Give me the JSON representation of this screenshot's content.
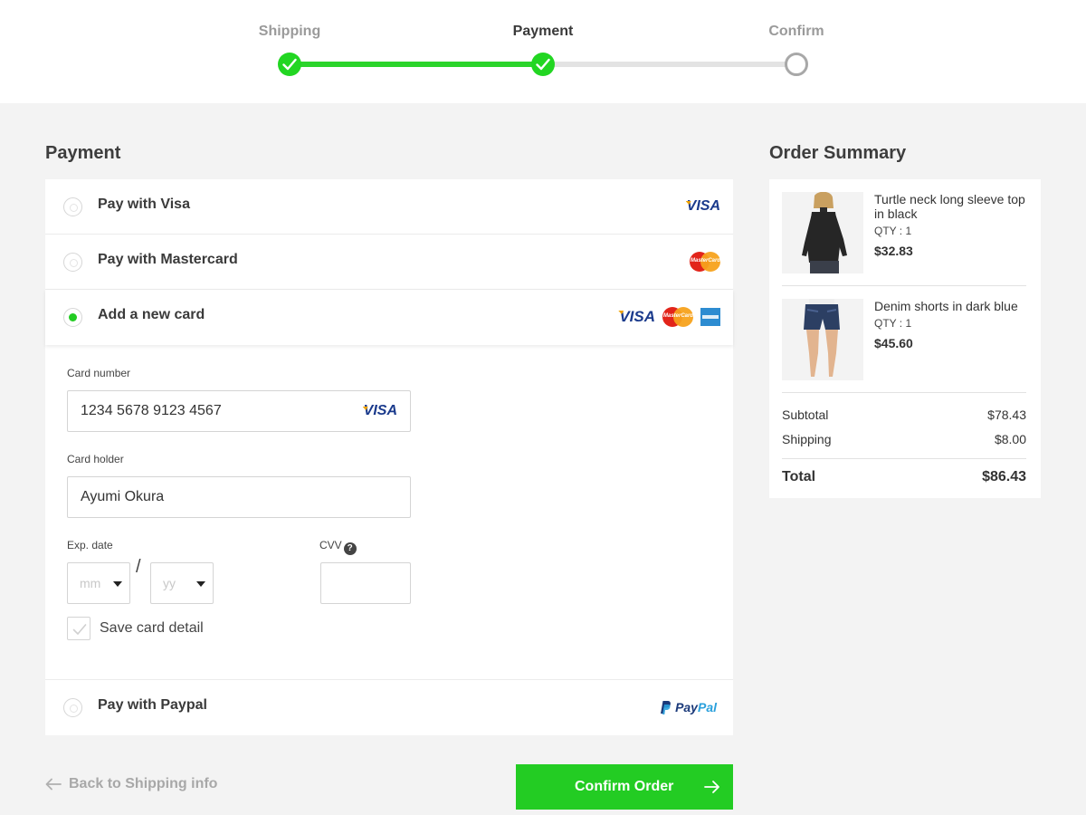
{
  "stepper": {
    "steps": [
      {
        "label": "Shipping",
        "state": "done"
      },
      {
        "label": "Payment",
        "state": "current"
      },
      {
        "label": "Confirm",
        "state": "todo"
      }
    ]
  },
  "payment": {
    "title": "Payment",
    "options": [
      {
        "label": "Pay with Visa",
        "selected": false,
        "logos": [
          "visa"
        ]
      },
      {
        "label": "Pay with Mastercard",
        "selected": false,
        "logos": [
          "mastercard"
        ]
      },
      {
        "label": "Add a new card",
        "selected": true,
        "logos": [
          "visa",
          "mastercard",
          "amex"
        ]
      },
      {
        "label": "Pay with Paypal",
        "selected": false,
        "logos": [
          "paypal"
        ]
      }
    ],
    "logo_text": {
      "visa": "VISA",
      "mastercard": "MasterCard",
      "paypal_a": "Pay",
      "paypal_b": "Pal"
    },
    "form": {
      "card_number_label": "Card number",
      "card_number_value": "1234 5678 9123 4567",
      "card_holder_label": "Card holder",
      "card_holder_value": "Ayumi Okura",
      "exp_label": "Exp. date",
      "exp_month_placeholder": "mm",
      "exp_year_placeholder": "yy",
      "exp_separator": "/",
      "cvv_label": "CVV",
      "cvv_help": "?",
      "cvv_value": "",
      "save_label": "Save card detail",
      "save_checked": false
    }
  },
  "actions": {
    "back_label": "Back to Shipping info",
    "confirm_label": "Confirm Order"
  },
  "summary": {
    "title": "Order Summary",
    "items": [
      {
        "name": "Turtle neck long sleeve top in black",
        "qty": "QTY : 1",
        "price": "$32.83",
        "image": "black-turtleneck-model"
      },
      {
        "name": "Denim shorts in dark blue",
        "qty": "QTY : 1",
        "price": "$45.60",
        "image": "denim-shorts-model"
      }
    ],
    "subtotal_label": "Subtotal",
    "subtotal_value": "$78.43",
    "shipping_label": "Shipping",
    "shipping_value": "$8.00",
    "total_label": "Total",
    "total_value": "$86.43"
  },
  "colors": {
    "accent_green": "#23cc23",
    "track_gray": "#e3e3e3",
    "visa_blue": "#1a3a8c"
  }
}
